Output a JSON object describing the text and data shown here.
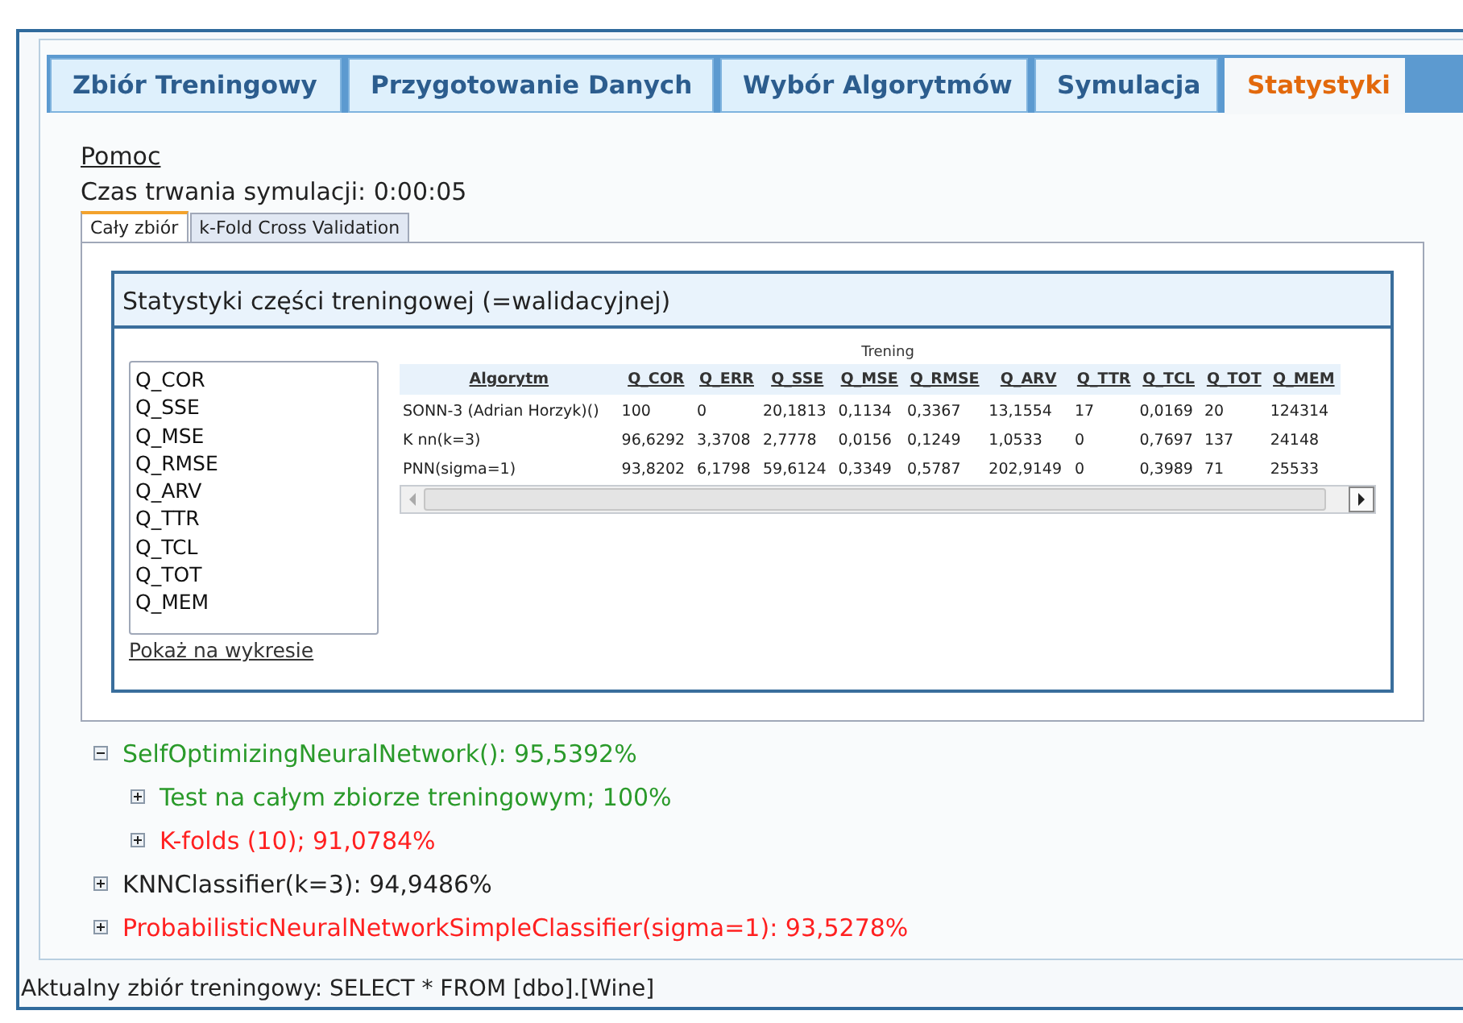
{
  "tabs": [
    {
      "label": "Zbiór Treningowy",
      "selected": false
    },
    {
      "label": "Przygotowanie Danych",
      "selected": false
    },
    {
      "label": "Wybór Algorytmów",
      "selected": false
    },
    {
      "label": "Symulacja",
      "selected": false
    },
    {
      "label": "Statystyki",
      "selected": true
    }
  ],
  "help_link": "Pomoc",
  "duration": "Czas trwania symulacji: 0:00:05",
  "subtabs": [
    {
      "label": "Cały zbiór",
      "selected": true
    },
    {
      "label": "k-Fold Cross Validation",
      "selected": false
    }
  ],
  "stats_panel": {
    "title": "Statystyki części treningowej (=walidacyjnej)",
    "measures": [
      "Q_COR",
      "Q_SSE",
      "Q_MSE",
      "Q_RMSE",
      "Q_ARV",
      "Q_TTR",
      "Q_TCL",
      "Q_TOT",
      "Q_MEM"
    ],
    "chart_link": "Pokaż na wykresie",
    "table": {
      "group_header": "Trening",
      "columns": [
        "Algorytm",
        "Q_COR",
        "Q_ERR",
        "Q_SSE",
        "Q_MSE",
        "Q_RMSE",
        "Q_ARV",
        "Q_TTR",
        "Q_TCL",
        "Q_TOT",
        "Q_MEM"
      ],
      "rows": [
        [
          "SONN-3 (Adrian Horzyk)()",
          "100",
          "0",
          "20,1813",
          "0,1134",
          "0,3367",
          "13,1554",
          "17",
          "0,0169",
          "20",
          "124314"
        ],
        [
          "K nn(k=3)",
          "96,6292",
          "3,3708",
          "2,7778",
          "0,0156",
          "0,1249",
          "1,0533",
          "0",
          "0,7697",
          "137",
          "24148"
        ],
        [
          "PNN(sigma=1)",
          "93,8202",
          "6,1798",
          "59,6124",
          "0,3349",
          "0,5787",
          "202,9149",
          "0",
          "0,3989",
          "71",
          "25533"
        ]
      ]
    }
  },
  "results": [
    {
      "label": "SelfOptimizingNeuralNetwork(): 95,5392%",
      "color": "#2a9a2a",
      "expanded": true,
      "children": [
        {
          "label": "Test na całym zbiorze treningowym; 100%",
          "color": "#2a9a2a",
          "expanded": false
        },
        {
          "label": "K-folds (10); 91,0784%",
          "color": "#ff2020",
          "expanded": false
        }
      ]
    },
    {
      "label": "KNNClassifier(k=3): 94,9486%",
      "color": "#222222",
      "expanded": false
    },
    {
      "label": "ProbabilisticNeuralNetworkSimpleClassifier(sigma=1): 93,5278%",
      "color": "#ff2020",
      "expanded": false
    }
  ],
  "status_bar": "Aktualny zbiór treningowy: SELECT * FROM [dbo].[Wine]"
}
